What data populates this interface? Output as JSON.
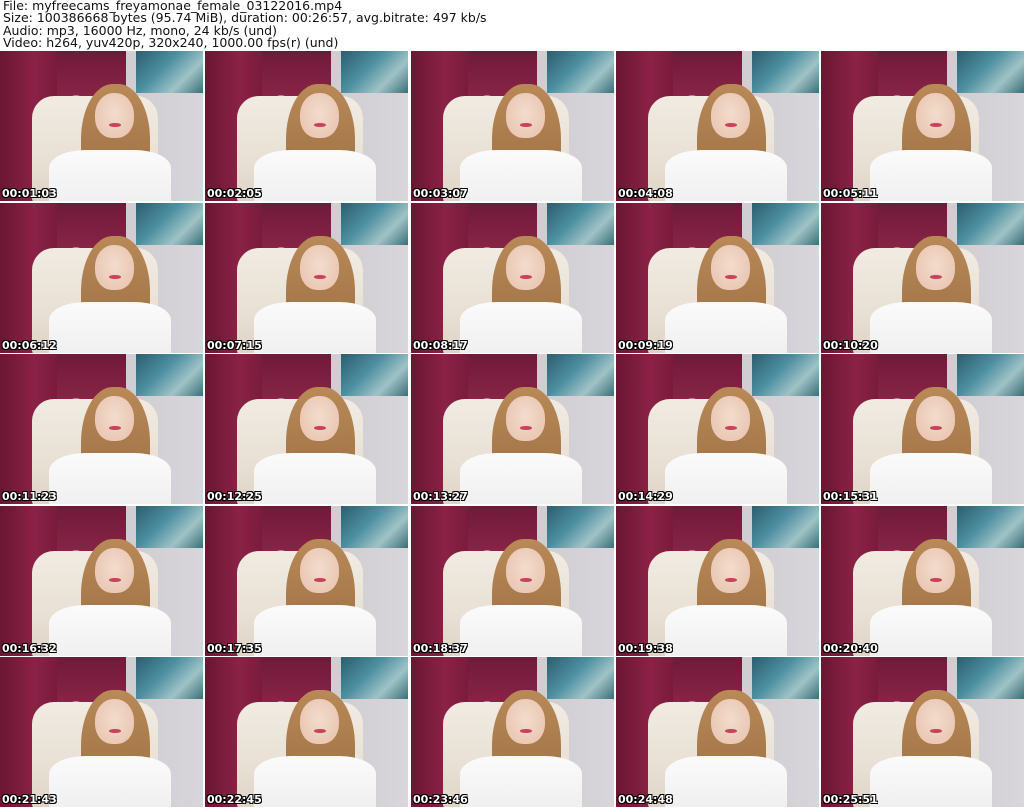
{
  "header": {
    "line1": "File: myfreecams_freyamonae_female_03122016.mp4",
    "line2": "Size: 100386668 bytes (95.74 MiB), duration: 00:26:57, avg.bitrate: 497 kb/s",
    "line3": "Audio: mp3, 16000 Hz, mono, 24 kb/s (und)",
    "line4": "Video: h264, yuv420p, 320x240, 1000.00 fps(r) (und)"
  },
  "thumbnails": [
    "00:01:03",
    "00:02:05",
    "00:03:07",
    "00:04:08",
    "00:05:11",
    "00:06:12",
    "00:07:15",
    "00:08:17",
    "00:09:19",
    "00:10:20",
    "00:11:23",
    "00:12:25",
    "00:13:27",
    "00:14:29",
    "00:15:31",
    "00:16:32",
    "00:17:35",
    "00:18:37",
    "00:19:38",
    "00:20:40",
    "00:21:43",
    "00:22:45",
    "00:23:46",
    "00:24:48",
    "00:25:51"
  ],
  "colors": {
    "curtain": "#8a2246",
    "wall": "#cfcbd0",
    "chair": "#e8e0d4",
    "hair": "#a5784a",
    "timestamp": "#ffffff"
  }
}
